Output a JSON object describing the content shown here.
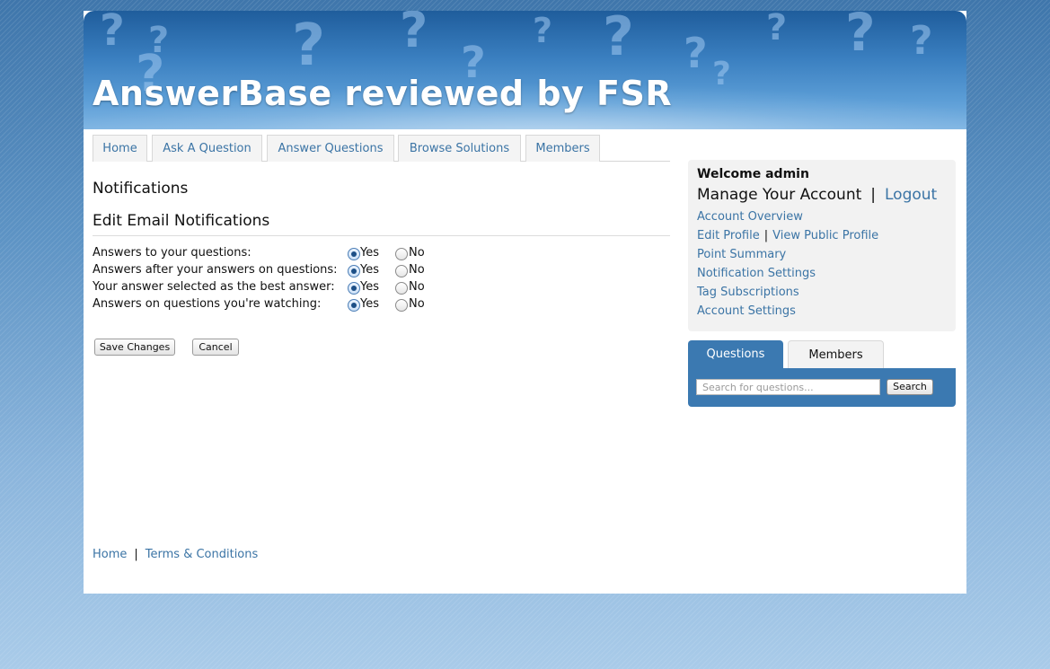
{
  "site": {
    "title": "AnswerBase reviewed by FSR"
  },
  "nav": {
    "tabs": [
      {
        "label": "Home"
      },
      {
        "label": "Ask A Question"
      },
      {
        "label": "Answer Questions"
      },
      {
        "label": "Browse Solutions"
      },
      {
        "label": "Members"
      }
    ]
  },
  "main": {
    "heading": "Notifications",
    "section_heading": "Edit Email Notifications",
    "preferences": [
      {
        "label": "Answers to your questions:",
        "selected": "Yes"
      },
      {
        "label": "Answers after your answers on questions:",
        "selected": "Yes"
      },
      {
        "label": "Your answer selected as the best answer:",
        "selected": "Yes"
      },
      {
        "label": "Answers on questions you're watching:",
        "selected": "Yes"
      }
    ],
    "yes_label": "Yes",
    "no_label": "No",
    "save_label": "Save Changes",
    "cancel_label": "Cancel"
  },
  "footer": {
    "home": "Home",
    "separator": "|",
    "terms": "Terms & Conditions"
  },
  "sidebar": {
    "welcome": "Welcome admin",
    "manage": "Manage Your Account",
    "separator": "|",
    "logout": "Logout",
    "links": {
      "overview": "Account Overview",
      "edit_profile": "Edit Profile",
      "view_public_profile": "View Public Profile",
      "point_summary": "Point Summary",
      "notification_settings": "Notification Settings",
      "tag_subscriptions": "Tag Subscriptions",
      "account_settings": "Account Settings"
    },
    "search": {
      "tabs": [
        {
          "label": "Questions",
          "active": true
        },
        {
          "label": "Members",
          "active": false
        }
      ],
      "placeholder": "Search for questions...",
      "button": "Search"
    }
  },
  "colors": {
    "link": "#3b74a5",
    "accent_blue": "#3b79b1"
  }
}
